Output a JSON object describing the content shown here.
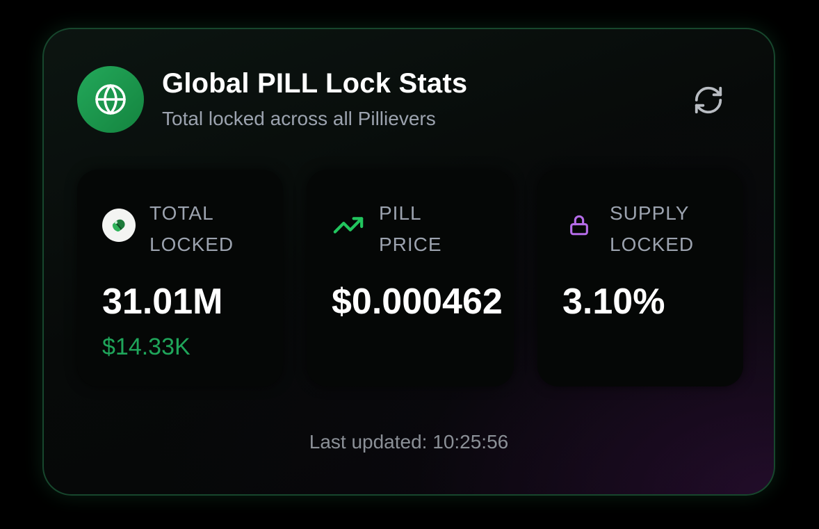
{
  "header": {
    "title": "Global PILL Lock Stats",
    "subtitle": "Total locked across all Pillievers",
    "icon": "globe-icon",
    "refresh_icon": "refresh-icon"
  },
  "stats": [
    {
      "icon": "pill-token-icon",
      "label_line1": "TOTAL",
      "label_line2": "LOCKED",
      "value": "31.01M",
      "sub_value": "$14.33K"
    },
    {
      "icon": "trending-up-icon",
      "label_line1": "PILL",
      "label_line2": "PRICE",
      "value": "$0.000462"
    },
    {
      "icon": "lock-icon",
      "label_line1": "SUPPLY",
      "label_line2": "LOCKED",
      "value": "3.10%"
    }
  ],
  "footer": {
    "last_updated": "Last updated: 10:25:56"
  },
  "colors": {
    "accent_green": "#1fa55a",
    "trend_green": "#22c55e",
    "lock_purple": "#b56ce8",
    "muted_text": "#9ca3af"
  }
}
